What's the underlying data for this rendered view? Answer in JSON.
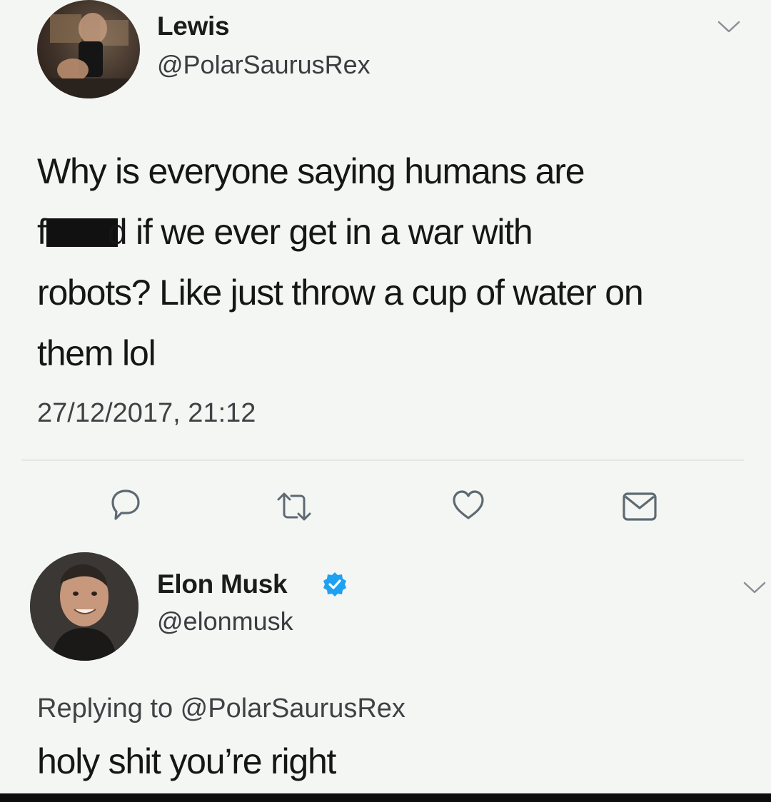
{
  "original_tweet": {
    "author_name": "Lewis",
    "author_handle": "@PolarSaurusRex",
    "text_line1": "Why is everyone saying humans are",
    "text_line2_prefix": "f",
    "text_line2_suffix": "d if we ever get in a war with",
    "text_line3": "robots? Like just throw a cup of water on",
    "text_line4": "them lol",
    "timestamp": "27/12/2017, 21:12",
    "actions": [
      "reply-icon",
      "retweet-icon",
      "like-icon",
      "direct-message-icon"
    ]
  },
  "reply_tweet": {
    "author_name": "Elon Musk",
    "author_handle": "@elonmusk",
    "verified": true,
    "replying_to_prefix": "Replying to ",
    "replying_to_handle": "@PolarSaurusRex",
    "text": "holy shit you’re right"
  },
  "colors": {
    "background": "#f4f6f4",
    "verified_blue": "#1da1f2",
    "icon_gray": "#5e6a72"
  }
}
